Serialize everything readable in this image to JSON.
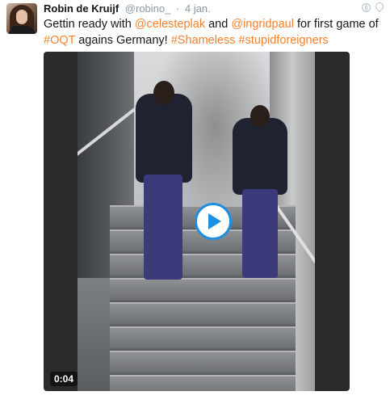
{
  "tweet": {
    "author_name": "Robin de Kruijf",
    "handle": "@robino_",
    "separator": "·",
    "time": "4 jan.",
    "text_parts": [
      {
        "text": "Gettin ready with ",
        "link": false
      },
      {
        "text": "@celesteplak",
        "link": true
      },
      {
        "text": " and ",
        "link": false
      },
      {
        "text": "@ingridpaul",
        "link": true
      },
      {
        "text": " for first game of ",
        "link": false
      },
      {
        "text": "#OQT",
        "link": true
      },
      {
        "text": " agains Germany! ",
        "link": false
      },
      {
        "text": "#Shameless",
        "link": true
      },
      {
        "text": " ",
        "link": false
      },
      {
        "text": "#stupidforeigners",
        "link": true
      }
    ]
  },
  "media": {
    "duration": "0:04",
    "play_icon": "play-icon"
  },
  "colors": {
    "link": "#f5812e",
    "play_accent": "#1d8fe0",
    "meta_gray": "#8899a6"
  }
}
